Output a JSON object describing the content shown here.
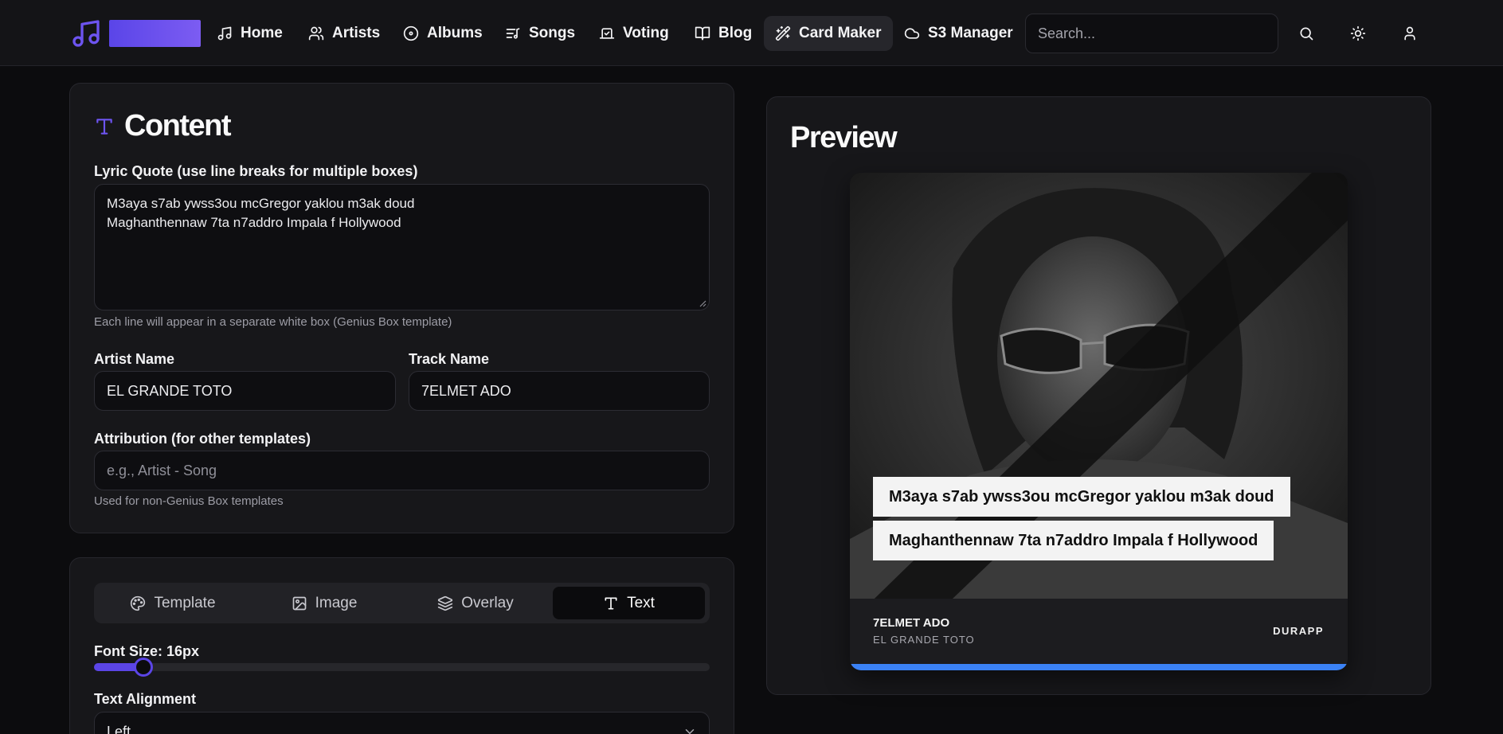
{
  "nav": {
    "items": [
      {
        "label": "Home",
        "icon": "music-note-icon"
      },
      {
        "label": "Artists",
        "icon": "users-icon"
      },
      {
        "label": "Albums",
        "icon": "disc-icon"
      },
      {
        "label": "Songs",
        "icon": "playlist-icon"
      },
      {
        "label": "Voting",
        "icon": "vote-icon"
      },
      {
        "label": "Blog",
        "icon": "book-icon"
      },
      {
        "label": "Card Maker",
        "icon": "magic-wand-icon",
        "active": true
      },
      {
        "label": "S3 Manager",
        "icon": "cloud-icon"
      }
    ],
    "search_placeholder": "Search...",
    "logo_icon": "music-notes-icon",
    "accent": "#6d54f0"
  },
  "content": {
    "title": "Content",
    "lyric_label": "Lyric Quote (use line breaks for multiple boxes)",
    "lyric_lines": [
      "M3aya s7ab ywss3ou mcGregor yaklou m3ak doud",
      "Maghanthennaw 7ta n7addro Impala f Hollywood"
    ],
    "lyric_hint": "Each line will appear in a separate white box (Genius Box template)",
    "artist_label": "Artist Name",
    "artist_value": "EL GRANDE TOTO",
    "track_label": "Track Name",
    "track_value": "7ELMET ADO",
    "attribution_label": "Attribution (for other templates)",
    "attribution_placeholder": "e.g., Artist - Song",
    "attribution_hint": "Used for non-Genius Box templates"
  },
  "settings": {
    "tabs": [
      {
        "label": "Template",
        "icon": "palette-icon"
      },
      {
        "label": "Image",
        "icon": "image-icon"
      },
      {
        "label": "Overlay",
        "icon": "layers-icon"
      },
      {
        "label": "Text",
        "icon": "type-icon",
        "active": true
      }
    ],
    "font_size_label": "Font Size: 16px",
    "font_size_fraction": 0.08,
    "alignment_label": "Text Alignment",
    "alignment_value": "Left"
  },
  "preview": {
    "title": "Preview",
    "boxes": [
      "M3aya s7ab ywss3ou mcGregor yaklou m3ak doud",
      "Maghanthennaw 7ta n7addro Impala f Hollywood"
    ],
    "track": "7ELMET ADO",
    "artist": "EL GRANDE TOTO",
    "brand": "DURAPP",
    "accent": "#3b82f6"
  }
}
